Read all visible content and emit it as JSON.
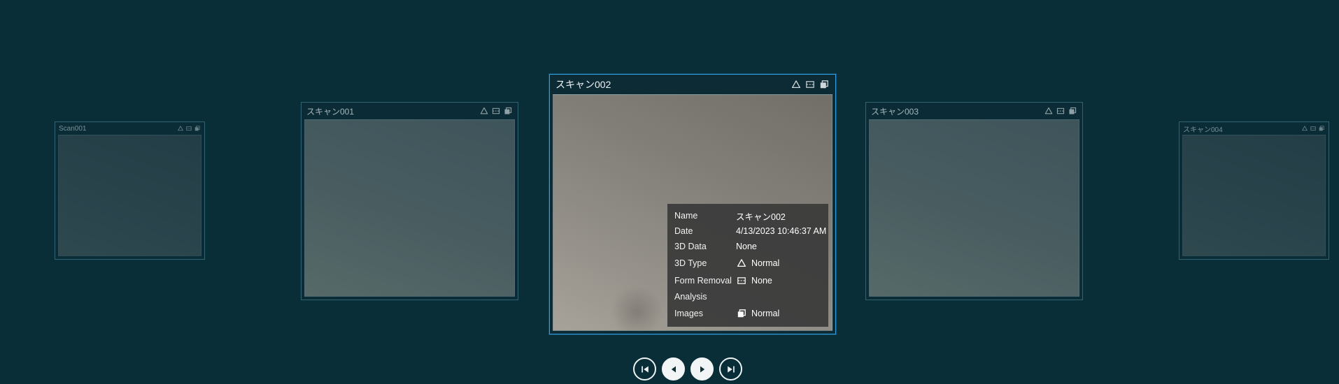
{
  "app": {
    "background_color": "#0a2e38",
    "accent_color": "#2e9fe0",
    "info_panel_color": "#393939"
  },
  "carousel": {
    "cards": [
      {
        "title": "Scan001",
        "selected": false
      },
      {
        "title": "スキャン001",
        "selected": false
      },
      {
        "title": "スキャン002",
        "selected": true
      },
      {
        "title": "スキャン003",
        "selected": false
      },
      {
        "title": "スキャン004",
        "selected": false
      }
    ],
    "card_icons": [
      "3d-type-triangle-icon",
      "form-removal-icon",
      "images-icon"
    ]
  },
  "info_panel": {
    "rows": [
      {
        "label": "Name",
        "value": "スキャン002"
      },
      {
        "label": "Date",
        "value": "4/13/2023 10:46:37 AM"
      },
      {
        "label": "3D Data",
        "value": "None"
      },
      {
        "label": "3D Type",
        "icon": "3d-type-triangle-icon",
        "value": "Normal"
      },
      {
        "label": "Form Removal",
        "icon": "form-removal-icon",
        "value": "None"
      },
      {
        "label": "Analysis",
        "value": ""
      },
      {
        "label": "Images",
        "icon": "images-icon",
        "value": "Normal"
      }
    ]
  },
  "navigation": {
    "buttons": [
      {
        "name": "first"
      },
      {
        "name": "previous"
      },
      {
        "name": "next"
      },
      {
        "name": "last"
      }
    ]
  }
}
